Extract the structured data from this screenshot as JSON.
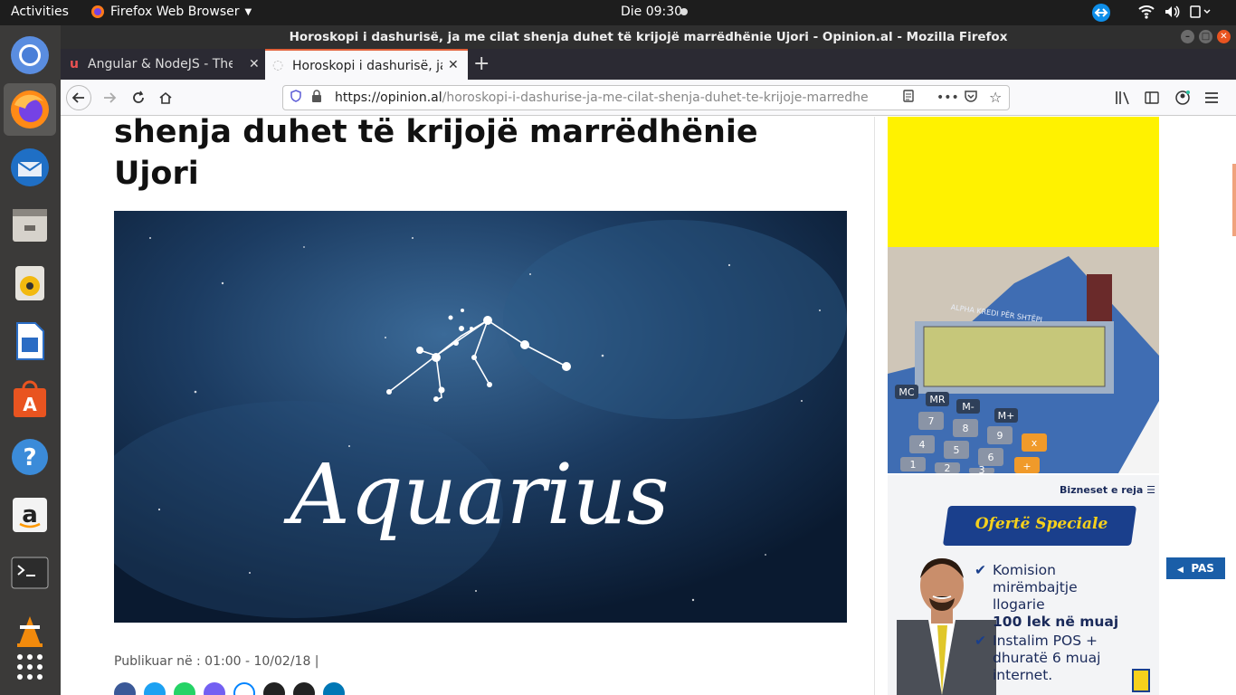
{
  "topbar": {
    "activities": "Activities",
    "app_name": "Firefox Web Browser",
    "clock": "Die 09:30"
  },
  "window": {
    "title": "Horoskopi i dashurisë, ja me cilat shenja duhet të krijojë marrëdhënie Ujori - Opinion.al - Mozilla Firefox"
  },
  "tabs": [
    {
      "label": "Angular & NodeJS - The M"
    },
    {
      "label": "Horoskopi i dashurisë, ja"
    }
  ],
  "navbar": {
    "url_host": "https://opinion.al",
    "url_path": "/horoskopi-i-dashurise-ja-me-cilat-shenja-duhet-te-krijoje-marredhenie"
  },
  "article": {
    "headline_line1": "shenja duhet të krijojë marrëdhënie",
    "headline_line2": "Ujori",
    "hero_text": "Aquarius",
    "published": "Publikuar në : 01:00 - 10/02/18 |"
  },
  "ads": {
    "calc_label": "ALPHA KREDI PËR SHTËPI",
    "calc_keys": [
      "MC",
      "MR",
      "M-",
      "M+",
      "7",
      "8",
      "9",
      "4",
      "5",
      "6",
      "x",
      "1",
      "2",
      "3",
      "+"
    ],
    "bank_menu": "Bizneset e reja",
    "bank_banner": "Ofertë Speciale",
    "bank_item1_line1": "Komision",
    "bank_item1_line2": "mirëmbajtje",
    "bank_item1_line3": "llogarie",
    "bank_item1_line4": "100 lek në muaj",
    "bank_item2_line1": "Instalim POS +",
    "bank_item2_line2": "dhuratë 6 muaj",
    "bank_item2_line3": "internet."
  },
  "pas": "PAS",
  "colors": {
    "topbar": "#1d1d1d",
    "dock": "#3b3a39",
    "tab_accent": "#e2613a",
    "ad_yellow": "#fff200",
    "bank_blue": "#1a4a9c"
  }
}
